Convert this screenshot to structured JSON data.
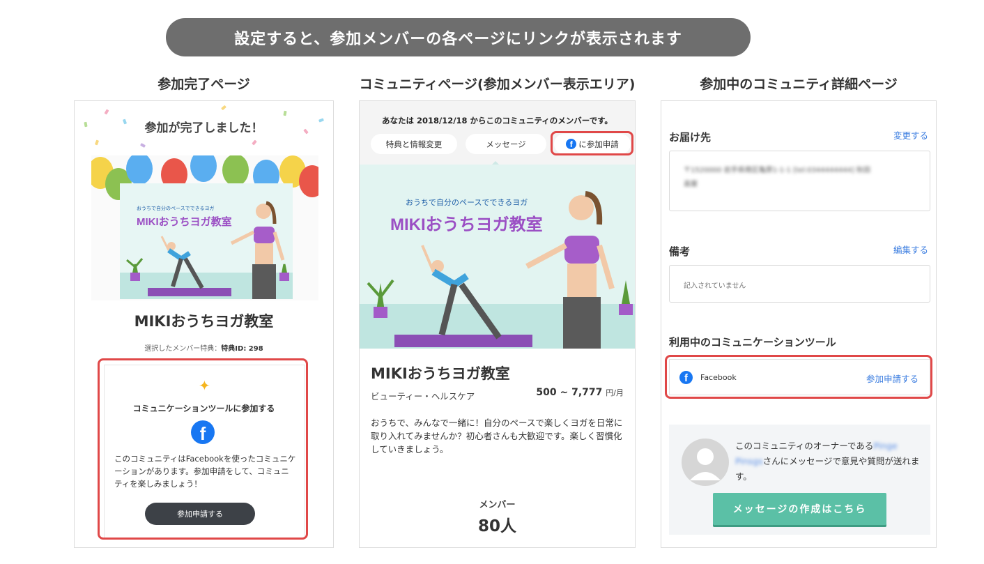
{
  "banner": "設定すると、参加メンバーの各ページにリンクが表示されます",
  "columns": {
    "c1": "参加完了ページ",
    "c2": "コミュニティページ(参加メンバー表示エリア)",
    "c3": "参加中のコミュニティ詳細ページ"
  },
  "panel1": {
    "heading": "参加が完了しました！",
    "hero_subtitle": "おうちで自分のペースでできるヨガ",
    "hero_title": "MIKIおうちヨガ教室",
    "title": "MIKIおうちヨガ教室",
    "benefit_prefix": "選択したメンバー特典：",
    "benefit_id": "特典ID: 298",
    "join_title": "コミュニケーションツールに参加する",
    "description": "このコミュニティはFacebookを使ったコミュニケーションがあります。参加申請をして、コミュニティを楽しみましょう！",
    "button": "参加申請する"
  },
  "panel2": {
    "since": "あなたは 2018/12/18 からこのコミュニティのメンバーです。",
    "tabs": [
      "特典と情報変更",
      "メッセージ",
      "に参加申請"
    ],
    "hero_subtitle": "おうちで自分のペースでできるヨガ",
    "hero_title": "MIKIおうちヨガ教室",
    "title": "MIKIおうちヨガ教室",
    "category": "ビューティー・ヘルスケア",
    "price": "500 ~ 7,777",
    "price_unit": "円/月",
    "description": "おうちで、みんなで一緒に！自分のペースで楽しくヨガを日常に取り入れてみませんか？初心者さんも大歓迎です。楽しく習慣化していきましょう。",
    "member_label": "メンバー",
    "member_count": "80人"
  },
  "panel3": {
    "address_label": "お届け先",
    "address_link": "変更する",
    "address_line1": "〒1520000 岩手県南区亀原1-1-1 [tel:0344444444] 秋田",
    "address_line2": "县屋",
    "note_label": "備考",
    "note_link": "編集する",
    "note_text": "記入されていません",
    "tools_label": "利用中のコミュニケーションツール",
    "tool_name": "Facebook",
    "tool_link": "参加申請する",
    "owner_text_1": "このコミュニティのオーナーである",
    "owner_name": "Pinge Pinsgs",
    "owner_text_2": "さんにメッセージで意見や質問が送れます。",
    "message_button": "メッセージの作成はこちら"
  },
  "colors": {
    "banner_bg": "#6e6e6e",
    "highlight_red": "#e04848",
    "facebook_blue": "#1877f2",
    "link_blue": "#3b7de0",
    "green_button": "#5bc0a6",
    "yoga_purple": "#9b4fc4"
  },
  "icons": [
    "facebook-icon",
    "sparkle-icon",
    "avatar-icon"
  ]
}
